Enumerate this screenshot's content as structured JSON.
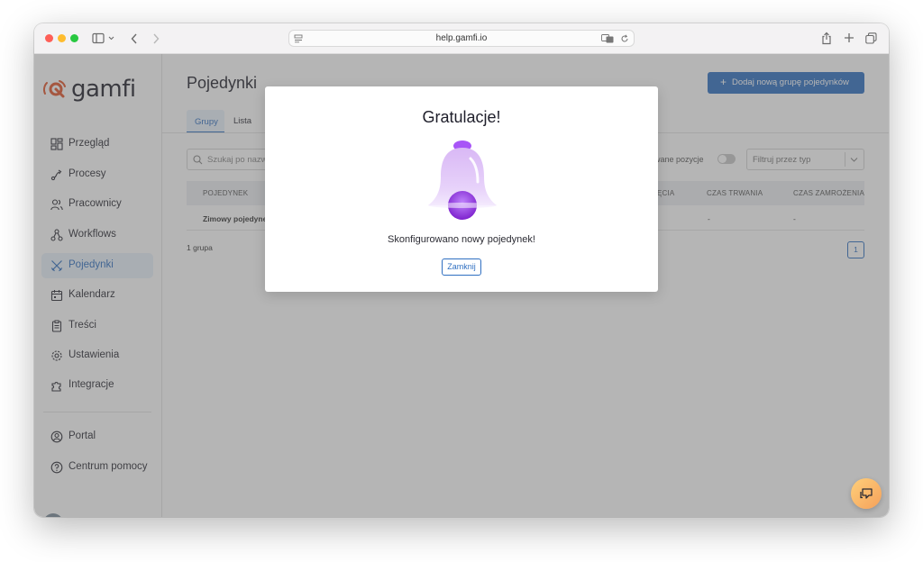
{
  "browser": {
    "url": "help.gamfi.io"
  },
  "sidebar": {
    "logo_text": "gamfi",
    "items": [
      {
        "label": "Przegląd",
        "icon": "dashboard-icon"
      },
      {
        "label": "Procesy",
        "icon": "process-icon"
      },
      {
        "label": "Pracownicy",
        "icon": "users-icon"
      },
      {
        "label": "Workflows",
        "icon": "workflow-icon"
      },
      {
        "label": "Pojedynki",
        "icon": "duel-icon",
        "active": true
      },
      {
        "label": "Kalendarz",
        "icon": "calendar-icon"
      },
      {
        "label": "Treści",
        "icon": "clipboard-icon"
      },
      {
        "label": "Ustawienia",
        "icon": "gear-icon"
      },
      {
        "label": "Integracje",
        "icon": "puzzle-icon"
      }
    ],
    "bottom_items": [
      {
        "label": "Portal",
        "icon": "user-circle-icon"
      },
      {
        "label": "Centrum pomocy",
        "icon": "help-icon"
      }
    ]
  },
  "main": {
    "title": "Pojedynki",
    "add_button_label": "Dodaj nową grupę pojedynków",
    "tabs": [
      {
        "label": "Grupy",
        "active": true
      },
      {
        "label": "Lista",
        "active": false
      }
    ],
    "search_placeholder": "Szukaj po nazw",
    "toggle_label": "wane pozycje",
    "filter_placeholder": "Filtruj przez typ",
    "table": {
      "headers": [
        "POJEDYNEK",
        "ĘCIA",
        "CZAS TRWANIA",
        "CZAS ZAMROŻENIA"
      ],
      "rows": [
        [
          "Zimowy pojedynek",
          "",
          "-",
          "-"
        ]
      ]
    },
    "count_text": "1 grupa",
    "page_number": "1"
  },
  "modal": {
    "title": "Gratulacje!",
    "message": "Skonfigurowano nowy pojedynek!",
    "close_label": "Zamknij"
  },
  "colors": {
    "accent": "#2f6fc1",
    "logo_orange": "#e2542b",
    "bell_purple": "#a855f7"
  }
}
